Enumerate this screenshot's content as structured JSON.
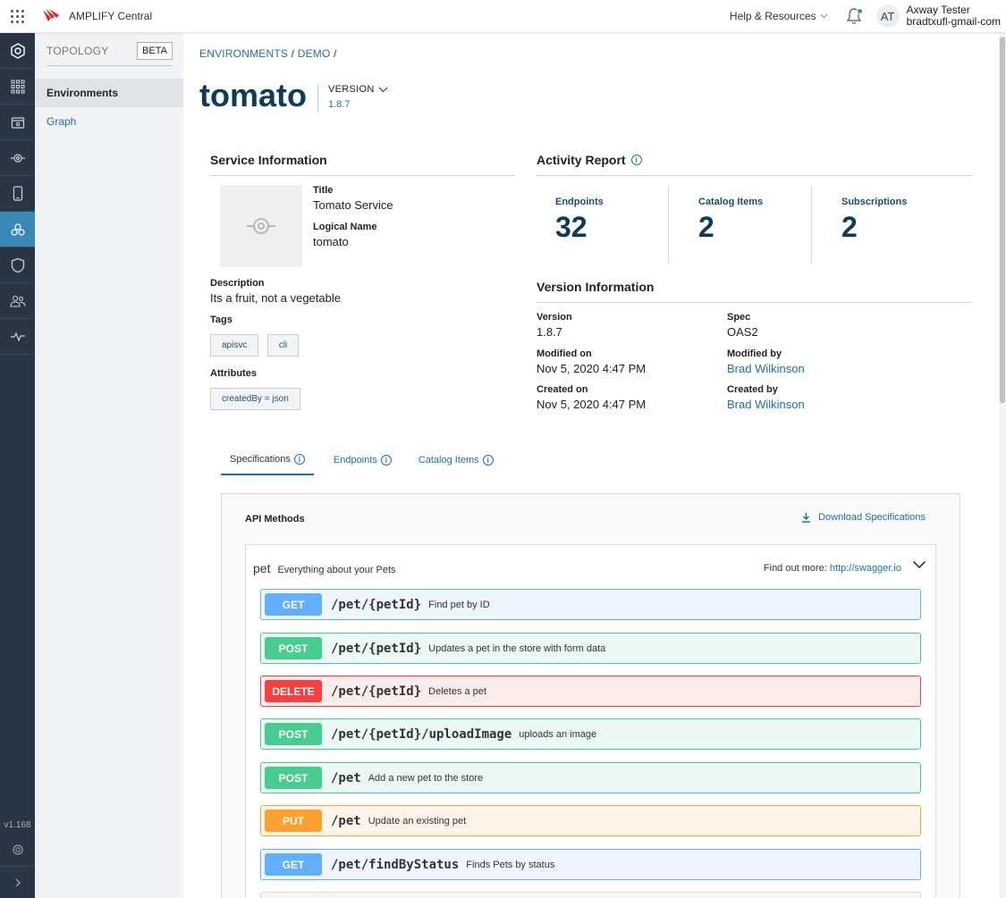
{
  "app": {
    "name": "AMPLIFY Central"
  },
  "header": {
    "help": "Help & Resources",
    "avatar_initials": "AT",
    "user_name": "Axway Tester",
    "user_email": "bradtxufl-gmail-com"
  },
  "rail": {
    "version": "v1.168"
  },
  "subnav": {
    "title": "TOPOLOGY",
    "badge": "BETA",
    "items": [
      "Environments",
      "Graph"
    ]
  },
  "breadcrumb": {
    "item1": "ENVIRONMENTS",
    "item2": "DEMO",
    "sep": "/"
  },
  "page": {
    "title": "tomato",
    "version_label": "VERSION",
    "version_value": "1.8.7"
  },
  "service_info": {
    "heading": "Service Information",
    "title_label": "Title",
    "title_value": "Tomato Service",
    "logical_label": "Logical Name",
    "logical_value": "tomato",
    "description_label": "Description",
    "description_value": "Its a fruit, not a vegetable",
    "tags_label": "Tags",
    "tags": [
      "apisvc",
      "cli"
    ],
    "attributes_label": "Attributes",
    "attributes": [
      "createdBy = json"
    ]
  },
  "activity": {
    "heading": "Activity Report",
    "stats": [
      {
        "label": "Endpoints",
        "value": "32"
      },
      {
        "label": "Catalog Items",
        "value": "2"
      },
      {
        "label": "Subscriptions",
        "value": "2"
      }
    ]
  },
  "version_info": {
    "heading": "Version Information",
    "version_label": "Version",
    "version_value": "1.8.7",
    "spec_label": "Spec",
    "spec_value": "OAS2",
    "modified_on_label": "Modified on",
    "modified_on_value": "Nov 5, 2020 4:47 PM",
    "modified_by_label": "Modified by",
    "modified_by_value": "Brad Wilkinson",
    "created_on_label": "Created on",
    "created_on_value": "Nov 5, 2020 4:47 PM",
    "created_by_label": "Created by",
    "created_by_value": "Brad Wilkinson"
  },
  "tabs": [
    "Specifications",
    "Endpoints",
    "Catalog Items"
  ],
  "api": {
    "heading": "API Methods",
    "download": "Download Specifications",
    "group_name": "pet",
    "group_desc": "Everything about your Pets",
    "find_more_label": "Find out more:",
    "find_more_link": "http://swagger.io",
    "operations": [
      {
        "method": "GET",
        "path": "/pet/{petId}",
        "summary": "Find pet by ID"
      },
      {
        "method": "POST",
        "path": "/pet/{petId}",
        "summary": "Updates a pet in the store with form data"
      },
      {
        "method": "DELETE",
        "path": "/pet/{petId}",
        "summary": "Deletes a pet"
      },
      {
        "method": "POST",
        "path": "/pet/{petId}/uploadImage",
        "summary": "uploads an image"
      },
      {
        "method": "POST",
        "path": "/pet",
        "summary": "Add a new pet to the store"
      },
      {
        "method": "PUT",
        "path": "/pet",
        "summary": "Update an existing pet"
      },
      {
        "method": "GET",
        "path": "/pet/findByStatus",
        "summary": "Finds Pets by status"
      }
    ]
  },
  "colors": {
    "accent": "#1f6fa5",
    "title": "#0d3b5a",
    "rail": "#2a3644",
    "rail_active": "#3b89b9"
  }
}
